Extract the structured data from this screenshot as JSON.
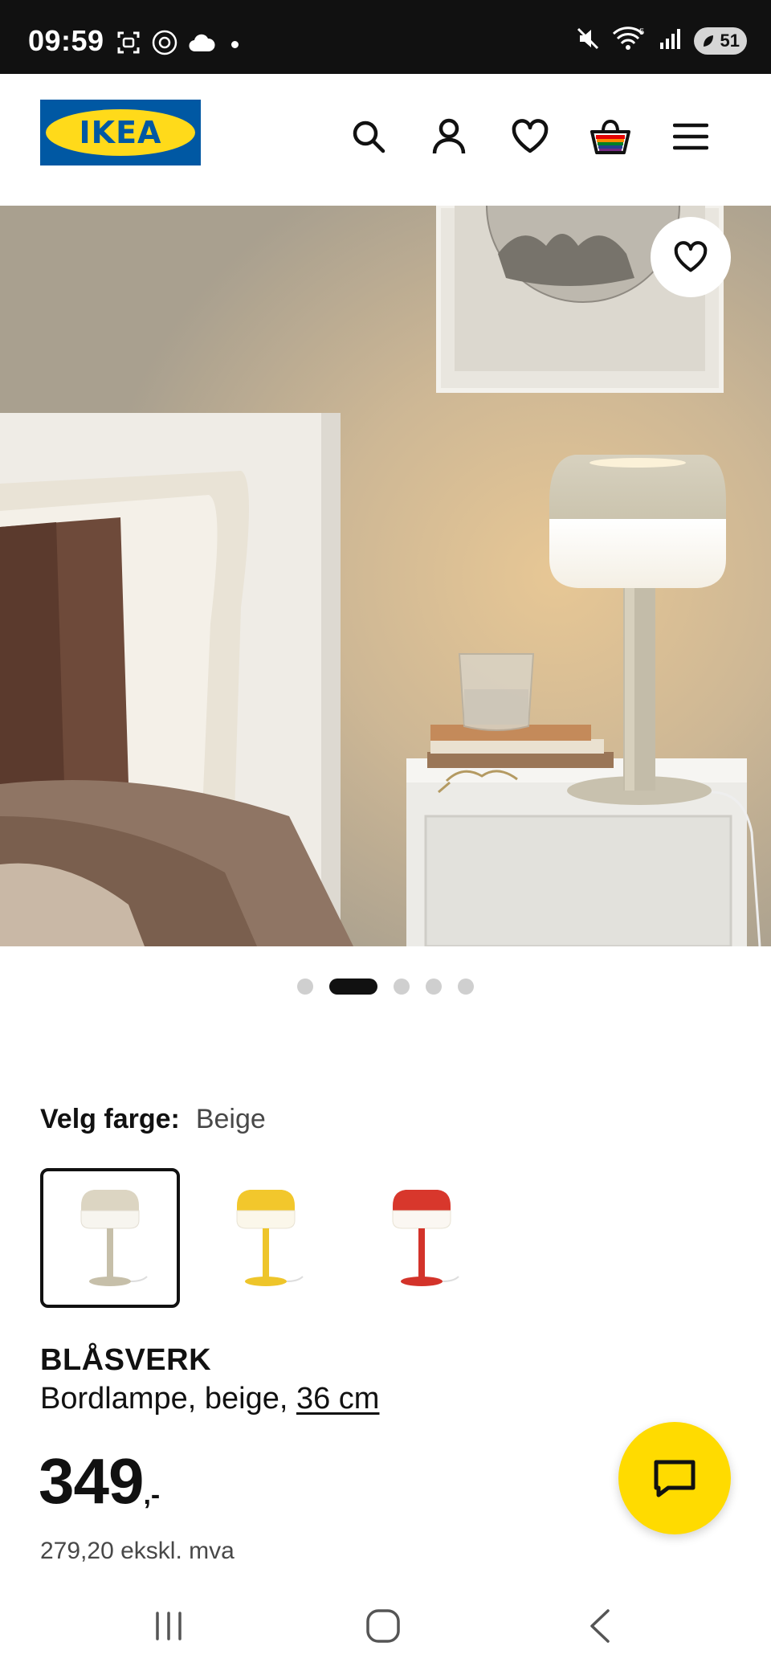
{
  "status_bar": {
    "time": "09:59",
    "battery": "51",
    "icons_left": [
      "screenshot-icon",
      "location-icon",
      "cloud-icon"
    ],
    "icons_right": [
      "mute-icon",
      "wifi-icon",
      "signal-icon",
      "battery-icon"
    ]
  },
  "header": {
    "logo_text": "IKEA",
    "icons": [
      "search-icon",
      "account-icon",
      "wishlist-heart-icon",
      "shopping-bag-icon",
      "menu-icon"
    ]
  },
  "carousel": {
    "total_images": 5,
    "active_index": 1
  },
  "color_select": {
    "label": "Velg farge:",
    "value": "Beige",
    "options": [
      {
        "name": "Beige",
        "color": "#d9d2bf",
        "selected": true
      },
      {
        "name": "Gul",
        "color": "#f2c72c",
        "selected": false
      },
      {
        "name": "Rød",
        "color": "#d8372c",
        "selected": false
      }
    ]
  },
  "product": {
    "name": "BLÅSVERK",
    "description_prefix": "Bordlampe, beige, ",
    "size_link": "36 cm",
    "price_main": "349",
    "price_suffix": ",-",
    "price_ex_vat": "279,20 ekskl. mva"
  },
  "colors": {
    "brand_blue": "#0058a3",
    "brand_yellow": "#ffda1a",
    "chat_yellow": "#ffdb00"
  }
}
